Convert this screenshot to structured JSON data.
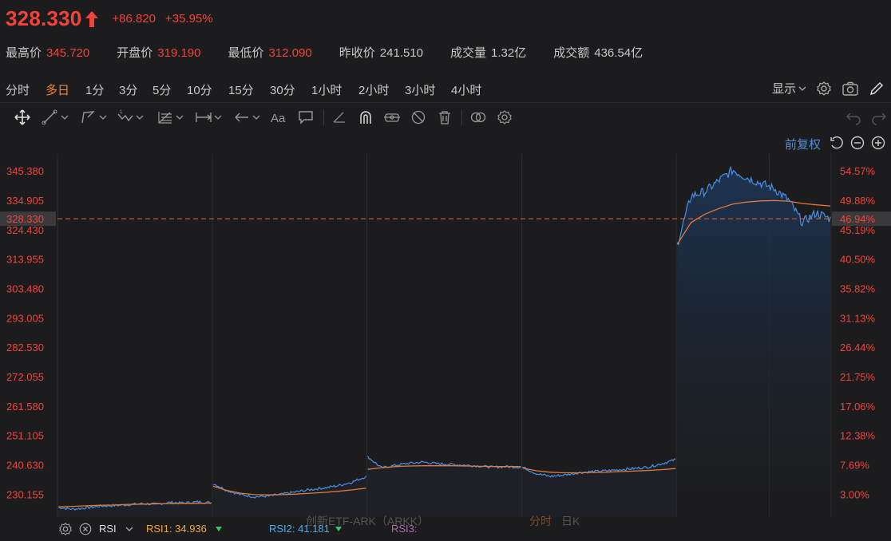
{
  "quote": {
    "price": "328.330",
    "change": "+86.820",
    "change_pct": "+35.95%",
    "stats": [
      {
        "label": "最高价",
        "value": "345.720",
        "color": "red"
      },
      {
        "label": "开盘价",
        "value": "319.190",
        "color": "red"
      },
      {
        "label": "最低价",
        "value": "312.090",
        "color": "red"
      },
      {
        "label": "昨收价",
        "value": "241.510",
        "color": "grey"
      },
      {
        "label": "成交量",
        "value": "1.32亿",
        "color": "grey"
      },
      {
        "label": "成交额",
        "value": "436.54亿",
        "color": "grey"
      }
    ]
  },
  "periods": [
    "分时",
    "多日",
    "1分",
    "3分",
    "5分",
    "10分",
    "15分",
    "30分",
    "1小时",
    "2小时",
    "3小时",
    "4小时"
  ],
  "active_period": "多日",
  "toolbar": {
    "display_label": "显示",
    "adjust_label": "前复权"
  },
  "chart_data": {
    "type": "line",
    "y_left_ticks": [
      "345.380",
      "334.905",
      "324.430",
      "313.955",
      "303.480",
      "293.005",
      "282.530",
      "272.055",
      "261.580",
      "251.105",
      "240.630",
      "230.155"
    ],
    "y_right_ticks": [
      "54.57%",
      "49.88%",
      "45.19%",
      "40.50%",
      "35.82%",
      "31.13%",
      "26.44%",
      "21.75%",
      "17.06%",
      "12.38%",
      "7.69%",
      "3.00%"
    ],
    "current_price_label": "328.330",
    "current_pct_label": "46.94%",
    "ylim": [
      222,
      350
    ],
    "days": [
      {
        "price": [
          225.5,
          224.8,
          225.3,
          225.9,
          226.1,
          226.4,
          226.8,
          226.6,
          227.2,
          227.0,
          227.4,
          227.1
        ],
        "avg": [
          225.6,
          225.8,
          226.0,
          226.2,
          226.3,
          226.5,
          226.6,
          226.7,
          226.8,
          226.9,
          226.9,
          227.0
        ]
      },
      {
        "price": [
          234.0,
          231.5,
          230.0,
          229.2,
          229.5,
          230.2,
          231.0,
          231.8,
          232.4,
          233.2,
          234.5,
          236.5
        ],
        "avg": [
          233.0,
          231.5,
          230.5,
          230.0,
          229.9,
          230.0,
          230.2,
          230.5,
          230.8,
          231.2,
          231.7,
          232.3
        ]
      },
      {
        "price": [
          243.5,
          239.5,
          240.5,
          241.2,
          241.6,
          241.0,
          240.8,
          240.5,
          240.2,
          239.8,
          240.0,
          239.8
        ],
        "avg": [
          239.0,
          239.6,
          240.0,
          240.2,
          240.3,
          240.3,
          240.3,
          240.2,
          240.1,
          240.0,
          240.0,
          240.0
        ]
      },
      {
        "price": [
          239.8,
          237.5,
          236.5,
          237.0,
          237.8,
          238.2,
          238.5,
          238.9,
          239.3,
          239.8,
          241.0,
          242.5
        ],
        "avg": [
          239.5,
          238.5,
          238.0,
          237.8,
          237.8,
          237.9,
          238.0,
          238.2,
          238.4,
          238.6,
          238.9,
          239.3
        ]
      },
      {
        "price": [
          319.2,
          336.5,
          338.0,
          342.0,
          345.7,
          343.0,
          341.0,
          339.0,
          335.0,
          327.0,
          330.5,
          328.33
        ],
        "avg": [
          319.2,
          327.0,
          330.0,
          332.0,
          333.6,
          334.3,
          334.7,
          334.8,
          334.6,
          333.8,
          333.3,
          332.9
        ]
      }
    ],
    "ref_price": 328.33,
    "colors": {
      "price_line": "#4a8fe6",
      "avg_line": "#e07a3a",
      "ref_line": "#e06a3a",
      "fill_top": "#1d3554"
    }
  },
  "watermark": {
    "name": "创新ETF-ARK（ARKK）",
    "mode_a": "分时",
    "mode_b": "日K"
  },
  "indicator": {
    "name": "RSI",
    "rsi1": "RSI1: 34.936",
    "rsi2": "RSI2: 41.181",
    "rsi3": "RSI3:"
  }
}
